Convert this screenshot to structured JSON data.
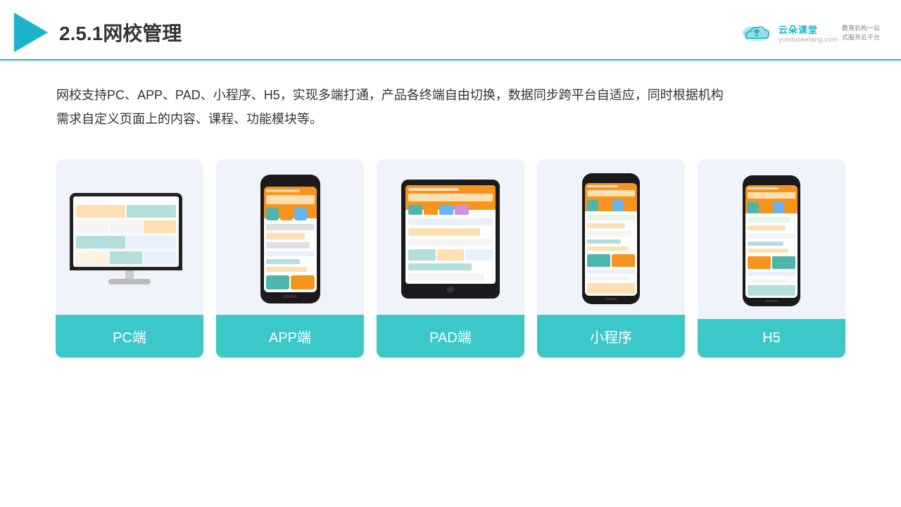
{
  "header": {
    "title": "2.5.1网校管理",
    "brand": {
      "name": "云朵课堂",
      "url": "yunduoketang.com",
      "tagline": "教育机构一站\n式服务云平台"
    }
  },
  "description": {
    "text": "网校支持PC、APP、PAD、小程序、H5，实现多端打通，产品各终端自由切换，数据同步跨平台自适应，同时根据机构\n需求自定义页面上的内容、课程、功能模块等。"
  },
  "cards": [
    {
      "id": "pc",
      "label": "PC端"
    },
    {
      "id": "app",
      "label": "APP端"
    },
    {
      "id": "pad",
      "label": "PAD端"
    },
    {
      "id": "mini",
      "label": "小程序"
    },
    {
      "id": "h5",
      "label": "H5"
    }
  ],
  "colors": {
    "teal": "#3cc8c8",
    "accent": "#1ab3c8",
    "dark": "#333"
  }
}
